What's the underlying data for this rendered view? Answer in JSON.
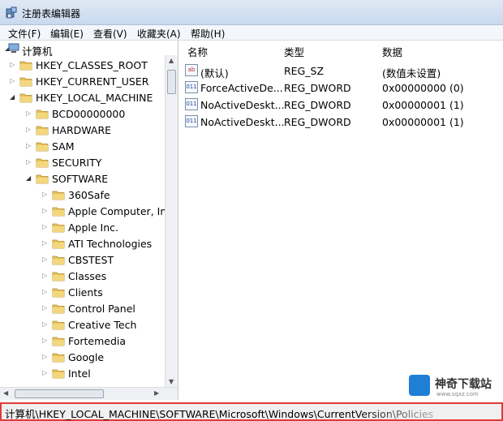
{
  "window": {
    "title": "注册表编辑器"
  },
  "menu": [
    "文件(F)",
    "编辑(E)",
    "查看(V)",
    "收藏夹(A)",
    "帮助(H)"
  ],
  "tree": {
    "root": "计算机",
    "items": [
      {
        "label": "HKEY_CLASSES_ROOT",
        "expanded": false
      },
      {
        "label": "HKEY_CURRENT_USER",
        "expanded": false
      },
      {
        "label": "HKEY_LOCAL_MACHINE",
        "expanded": true
      },
      {
        "label": "BCD00000000",
        "expanded": false
      },
      {
        "label": "HARDWARE",
        "expanded": false
      },
      {
        "label": "SAM",
        "expanded": false
      },
      {
        "label": "SECURITY",
        "expanded": false
      },
      {
        "label": "SOFTWARE",
        "expanded": true
      },
      {
        "label": "360Safe",
        "expanded": false
      },
      {
        "label": "Apple Computer, Inc",
        "expanded": false
      },
      {
        "label": "Apple Inc.",
        "expanded": false
      },
      {
        "label": "ATI Technologies",
        "expanded": false
      },
      {
        "label": "CBSTEST",
        "expanded": false
      },
      {
        "label": "Classes",
        "expanded": false
      },
      {
        "label": "Clients",
        "expanded": false
      },
      {
        "label": "Control Panel",
        "expanded": false
      },
      {
        "label": "Creative Tech",
        "expanded": false
      },
      {
        "label": "Fortemedia",
        "expanded": false
      },
      {
        "label": "Google",
        "expanded": false
      },
      {
        "label": "Intel",
        "expanded": false
      }
    ]
  },
  "columns": {
    "name": "名称",
    "type": "类型",
    "data": "数据"
  },
  "values": [
    {
      "name": "(默认)",
      "type": "REG_SZ",
      "data": "(数值未设置)",
      "icon": "string-value-icon"
    },
    {
      "name": "ForceActiveDe...",
      "type": "REG_DWORD",
      "data": "0x00000000 (0)",
      "icon": "dword-value-icon"
    },
    {
      "name": "NoActiveDeskt...",
      "type": "REG_DWORD",
      "data": "0x00000001 (1)",
      "icon": "dword-value-icon"
    },
    {
      "name": "NoActiveDeskt...",
      "type": "REG_DWORD",
      "data": "0x00000001 (1)",
      "icon": "dword-value-icon"
    }
  ],
  "status": {
    "path": "计算机\\HKEY_LOCAL_MACHINE\\SOFTWARE\\Microsoft\\Windows\\CurrentVersion\\Policies"
  },
  "watermark": {
    "text": "神奇下载站",
    "sub": "www.sqxz.com"
  },
  "colors": {
    "folder": "#e8c25a",
    "status_border": "#e03a3a",
    "logo": "#1e7fd4"
  }
}
